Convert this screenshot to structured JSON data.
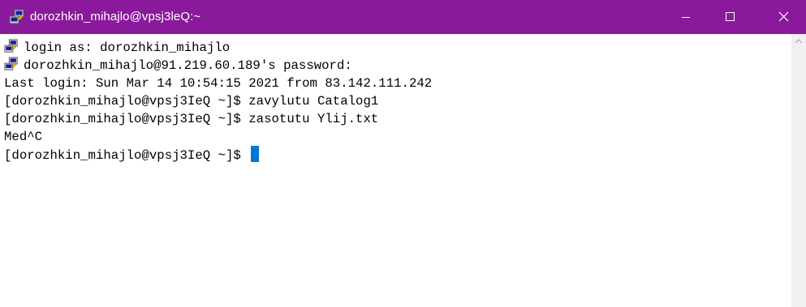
{
  "window": {
    "title": "dorozhkin_mihajlo@vpsj3leQ:~",
    "title_bar_color": "#8a1a9b",
    "icon": "putty-icon",
    "controls": {
      "minimize": "minimize-icon",
      "maximize": "maximize-icon",
      "close": "close-icon"
    }
  },
  "terminal": {
    "lines": [
      {
        "icon": "putty-icon",
        "text": "login as: dorozhkin_mihajlo"
      },
      {
        "icon": "putty-icon",
        "text": "dorozhkin_mihajlo@91.219.60.189's password:"
      },
      {
        "text": "Last login: Sun Mar 14 10:54:15 2021 from 83.142.111.242"
      },
      {
        "text": "[dorozhkin_mihajlo@vpsj3IeQ ~]$ zavylutu Catalog1"
      },
      {
        "text": "[dorozhkin_mihajlo@vpsj3IeQ ~]$ zasotutu Ylij.txt"
      },
      {
        "text": "Med^C"
      },
      {
        "text": "[dorozhkin_mihajlo@vpsj3IeQ ~]$ "
      }
    ],
    "cursor_color": "#0078d7"
  }
}
